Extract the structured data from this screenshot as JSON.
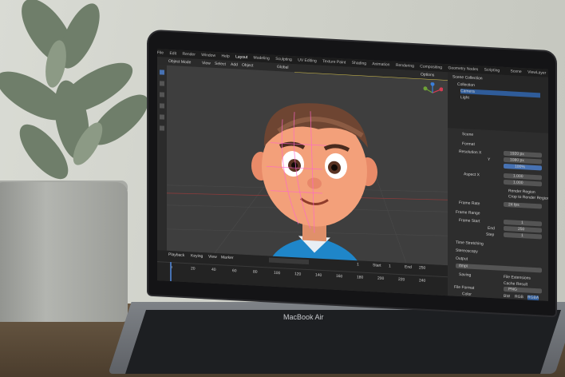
{
  "laptop": {
    "brand": "MacBook Air"
  },
  "app": {
    "menu": [
      "File",
      "Edit",
      "Render",
      "Window",
      "Help",
      "Layout",
      "Modeling",
      "Sculpting",
      "UV Editing",
      "Texture Paint",
      "Shading",
      "Animation",
      "Rendering",
      "Compositing",
      "Geometry Nodes",
      "Scripting"
    ],
    "scene_label": "Scene",
    "view_layer_label": "ViewLayer",
    "viewport_mode": "Object Mode",
    "viewport_menu": [
      "View",
      "Select",
      "Add",
      "Object"
    ],
    "transform": "Global",
    "options_label": "Options",
    "outliner": {
      "title": "Scene Collection",
      "items": [
        "Collection",
        "Camera",
        "Light"
      ]
    },
    "properties": {
      "search_placeholder": "",
      "scene_label": "Scene",
      "format_header": "Format",
      "resolution_x_label": "Resolution X",
      "resolution_x": "1920 px",
      "resolution_y_label": "Y",
      "resolution_y": "1080 px",
      "resolution_percent": "100%",
      "aspect_x_label": "Aspect X",
      "aspect_x": "1.000",
      "aspect_y": "1.000",
      "render_region": "Render Region",
      "crop_region": "Crop to Render Region",
      "frame_rate_label": "Frame Rate",
      "frame_rate": "24 fps",
      "frame_range_header": "Frame Range",
      "frame_start_label": "Frame Start",
      "frame_start": "1",
      "frame_end_label": "End",
      "frame_end": "250",
      "frame_step_label": "Step",
      "frame_step": "1",
      "time_stretching": "Time Stretching",
      "stereoscopy": "Stereoscopy",
      "output_header": "Output",
      "output_path": "/tmp\\",
      "saving_label": "Saving",
      "file_extensions": "File Extensions",
      "cache_result": "Cache Result",
      "file_format_label": "File Format",
      "file_format": "PNG",
      "color_label": "Color",
      "color_values": [
        "BW",
        "RGB",
        "RGBA"
      ]
    },
    "timeline": {
      "menu": [
        "Playback",
        "Keying",
        "View",
        "Marker"
      ],
      "ticks": [
        "0",
        "20",
        "40",
        "60",
        "80",
        "100",
        "120",
        "140",
        "160",
        "180",
        "200",
        "220",
        "240"
      ],
      "current_frame": "1",
      "start_label": "Start",
      "start": "1",
      "end_label": "End",
      "end": "250"
    }
  }
}
